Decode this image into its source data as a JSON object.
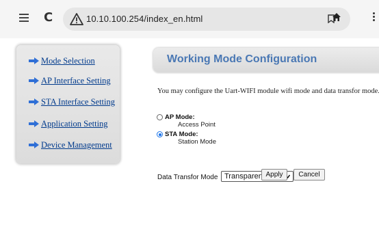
{
  "browser": {
    "url": "10.10.100.254/index_en.html"
  },
  "sidebar": {
    "items": [
      {
        "label": "Mode Selection"
      },
      {
        "label": "AP Interface Setting"
      },
      {
        "label": "STA Interface Setting"
      },
      {
        "label": "Application Setting"
      },
      {
        "label": "Device Management"
      }
    ]
  },
  "main": {
    "title": "Working Mode Configuration",
    "description": "You may configure the Uart-WIFI module wifi mode and data transfor mode.",
    "modes": [
      {
        "label": "AP Mode:",
        "sub": "Access Point",
        "checked": false
      },
      {
        "label": "STA Mode:",
        "sub": "Station Mode",
        "checked": true
      }
    ],
    "transfer_label": "Data Transfor Mode",
    "transfer_value": "Transparent Mode",
    "apply_label": "Apply",
    "cancel_label": "Cancel"
  },
  "colors": {
    "link": "#003a8c",
    "title": "#4a78b4",
    "arrow": "#2f6fd6"
  }
}
